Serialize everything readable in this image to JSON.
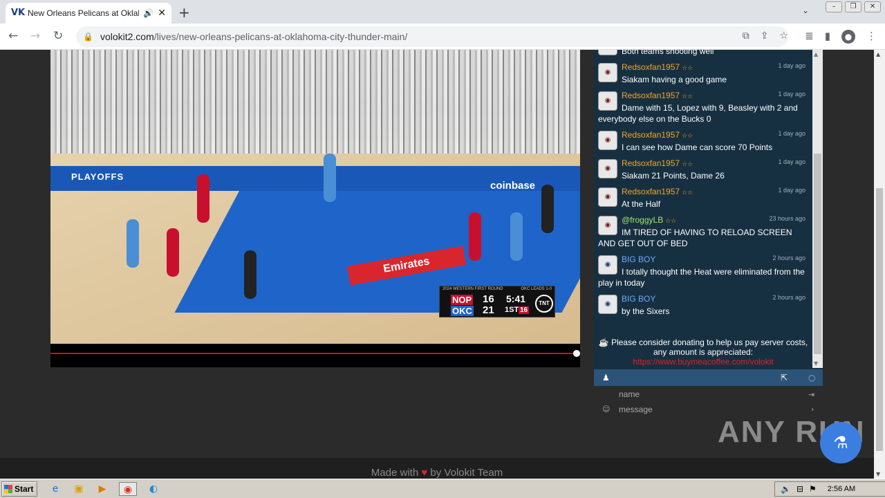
{
  "browser": {
    "tab_title": "New Orleans Pelicans at Oklahoma City Thunder",
    "favicon": "VK",
    "url_host": "volokit2.com",
    "url_path": "/lives/new-orleans-pelicans-at-oklahoma-city-thunder-main/",
    "new_tab": "+",
    "close_tab": "✕"
  },
  "video": {
    "banner_text": "PLAYOFFS",
    "sponsor1": "coinbase",
    "sponsor2": "Emirates",
    "scorebug": {
      "header": "2024 WESTERN FIRST ROUND",
      "series": "OKC LEADS 1-0",
      "team1": "NOP",
      "score1": "16",
      "team2": "OKC",
      "score2": "21",
      "clock": "5:41",
      "quarter": "1ST",
      "shot_clock": "16",
      "network": "TNT"
    },
    "progress_fraction": 1.0
  },
  "chat": {
    "messages": [
      {
        "user": "",
        "stars": "",
        "time": "",
        "text": "Both teams shooting well",
        "color": "orange"
      },
      {
        "user": "Redsoxfan1957",
        "stars": "☆☆",
        "time": "1 day ago",
        "text": "Siakam having a good game",
        "color": "orange"
      },
      {
        "user": "Redsoxfan1957",
        "stars": "☆☆",
        "time": "1 day ago",
        "text": "Dame with 15, Lopez with 9, Beasley with 2 and everybody else on the Bucks 0",
        "color": "orange"
      },
      {
        "user": "Redsoxfan1957",
        "stars": "☆☆",
        "time": "1 day ago",
        "text": "I can see how Dame can score 70 Points",
        "color": "orange"
      },
      {
        "user": "Redsoxfan1957",
        "stars": "☆☆",
        "time": "1 day ago",
        "text": "Siakam 21 Points, Dame 26",
        "color": "orange"
      },
      {
        "user": "Redsoxfan1957",
        "stars": "☆☆",
        "time": "1 day ago",
        "text": "At the Half",
        "color": "orange"
      },
      {
        "user": "@froggyLB",
        "stars": "☆☆",
        "time": "23 hours ago",
        "text": "IM TIRED OF HAVING TO RELOAD SCREEN AND GET OUT OF BED",
        "color": "green"
      },
      {
        "user": "BIG BOY",
        "stars": "",
        "time": "2 hours ago",
        "text": "I totally thought the Heat were eliminated from the play in today",
        "color": "blue"
      },
      {
        "user": "BIG BOY",
        "stars": "",
        "time": "2 hours ago",
        "text": "by the Sixers",
        "color": "blue"
      }
    ],
    "donate_text": "Please consider donating to help us pay server costs, any amount is appreciated:",
    "donate_link": "https://www.buymeacoffee.com/volokit",
    "name_placeholder": "name",
    "message_placeholder": "message"
  },
  "footer": {
    "made_with": "Made with",
    "by": "by Volokit Team"
  },
  "watermark": "ANY RUN",
  "taskbar": {
    "start": "Start",
    "time": "2:56 AM"
  },
  "colors": {
    "chat_bg": "#173041",
    "chat_bar": "#2c5378",
    "accent_red": "#d9262e",
    "username_orange": "#f5a623"
  }
}
